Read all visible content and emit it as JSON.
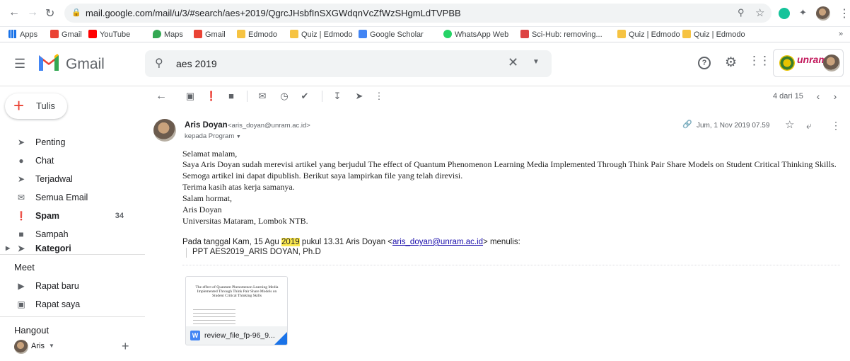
{
  "browser": {
    "url": "mail.google.com/mail/u/3/#search/aes+2019/QgrcJHsbfInSXGWdqnVcZfWzSHgmLdTVPBB",
    "bookmarks": [
      "Apps",
      "Gmail",
      "YouTube",
      "Maps",
      "Gmail",
      "Edmodo",
      "Quiz | Edmodo",
      "Google Scholar",
      "WhatsApp Web",
      "Sci-Hub: removing...",
      "Quiz | Edmodo",
      "Quiz | Edmodo"
    ]
  },
  "header": {
    "app_name": "Gmail",
    "search_value": "aes 2019",
    "brand_logo_text": "unram"
  },
  "sidebar": {
    "compose_label": "Tulis",
    "items": [
      {
        "label": "Penting",
        "count": ""
      },
      {
        "label": "Chat",
        "count": ""
      },
      {
        "label": "Terjadwal",
        "count": ""
      },
      {
        "label": "Semua Email",
        "count": ""
      },
      {
        "label": "Spam",
        "count": "34"
      },
      {
        "label": "Sampah",
        "count": ""
      },
      {
        "label": "Kategori",
        "count": ""
      }
    ],
    "meet_label": "Meet",
    "meet_items": [
      "Rapat baru",
      "Rapat saya"
    ],
    "hangout_label": "Hangout",
    "hangout_user": "Aris"
  },
  "toolbar": {
    "pagination": "4 dari 15"
  },
  "message": {
    "sender_name": "Aris Doyan",
    "sender_email": "<aris_doyan@unram.ac.id>",
    "recipient": "kepada Program",
    "date": "Jum, 1 Nov 2019 07.59",
    "body": [
      "Selamat malam,",
      "Saya Aris Doyan sudah merevisi artikel yang berjudul  The effect of Quantum Phenomenon Learning Media Implemented Through Think Pair Share Models on Student Critical Thinking Skills.",
      "Semoga artikel ini dapat dipublish. Berikut saya lampirkan file yang telah direvisi.",
      "Terima kasih atas kerja samanya.",
      "Salam hormat,",
      "Aris Doyan",
      "Universitas Mataram, Lombok NTB."
    ],
    "quote_prefix": "Pada tanggal Kam, 15 Agu ",
    "quote_highlight": "2019",
    "quote_middle": " pukul 13.31 Aris Doyan <",
    "quote_link": "aris_doyan@unram.ac.id",
    "quote_suffix": "> menulis:",
    "quoted_line": "PPT AES2019_ARIS DOYAN, Ph.D",
    "attachment": {
      "name": "review_file_fp-96_9...",
      "thumb_title": "The effect of Quantum Phenomenon Learning Media Implemented Through Think Pair Share Models on Student Critical Thinking Skills"
    }
  }
}
